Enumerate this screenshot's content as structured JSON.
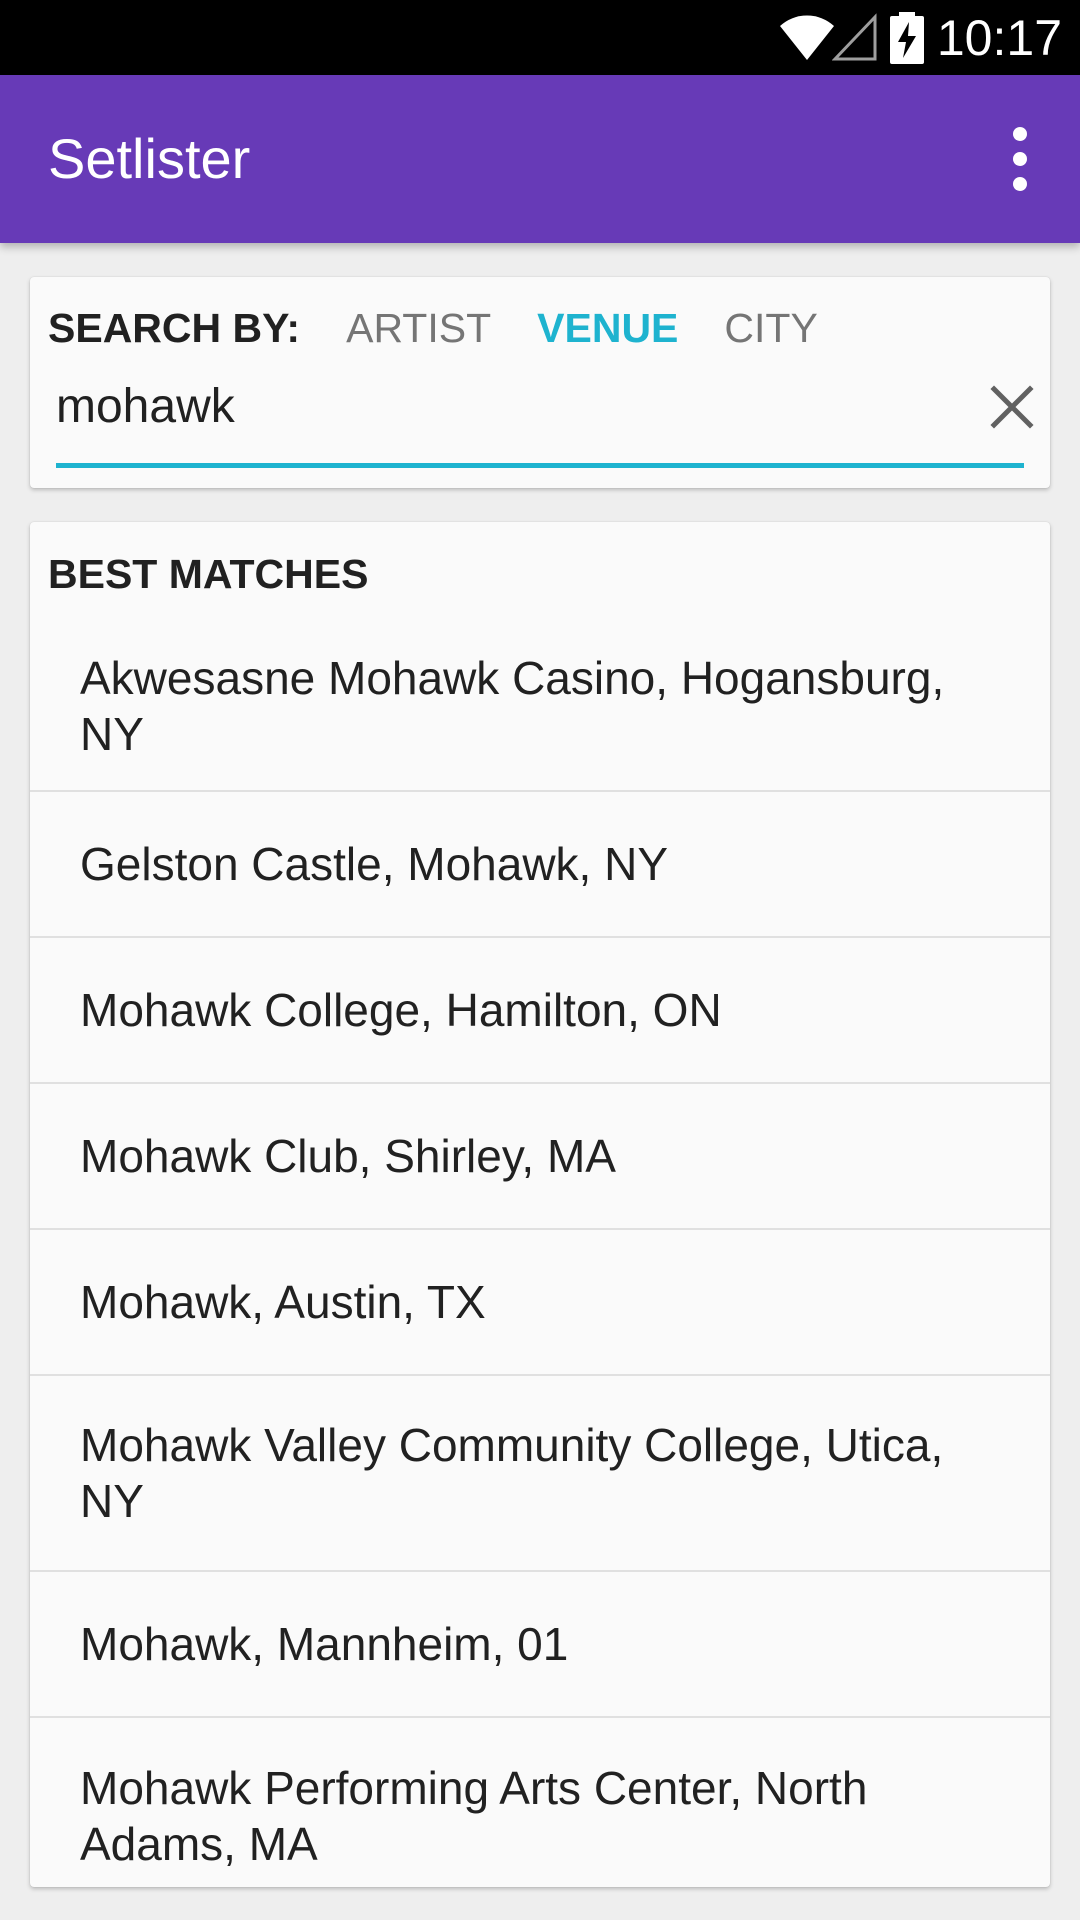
{
  "status_bar": {
    "time": "10:17",
    "icons": [
      "wifi-icon",
      "signal-icon",
      "battery-charging-icon"
    ]
  },
  "app_bar": {
    "title": "Setlister",
    "menu_icon": "overflow-menu-icon",
    "color": "#673ab7"
  },
  "search": {
    "label": "SEARCH BY:",
    "options": [
      {
        "label": "ARTIST",
        "active": false
      },
      {
        "label": "VENUE",
        "active": true
      },
      {
        "label": "CITY",
        "active": false
      }
    ],
    "query": "mohawk",
    "clear_icon": "close-icon",
    "accent_color": "#1eb3cf"
  },
  "results": {
    "header": "BEST MATCHES",
    "items": [
      "Akwesasne Mohawk Casino, Hogansburg, NY",
      "Gelston Castle, Mohawk, NY",
      "Mohawk College, Hamilton, ON",
      "Mohawk Club, Shirley, MA",
      "Mohawk, Austin, TX",
      "Mohawk Valley Community College, Utica, NY",
      "Mohawk, Mannheim, 01",
      "Mohawk Performing Arts Center, North Adams, MA"
    ]
  }
}
